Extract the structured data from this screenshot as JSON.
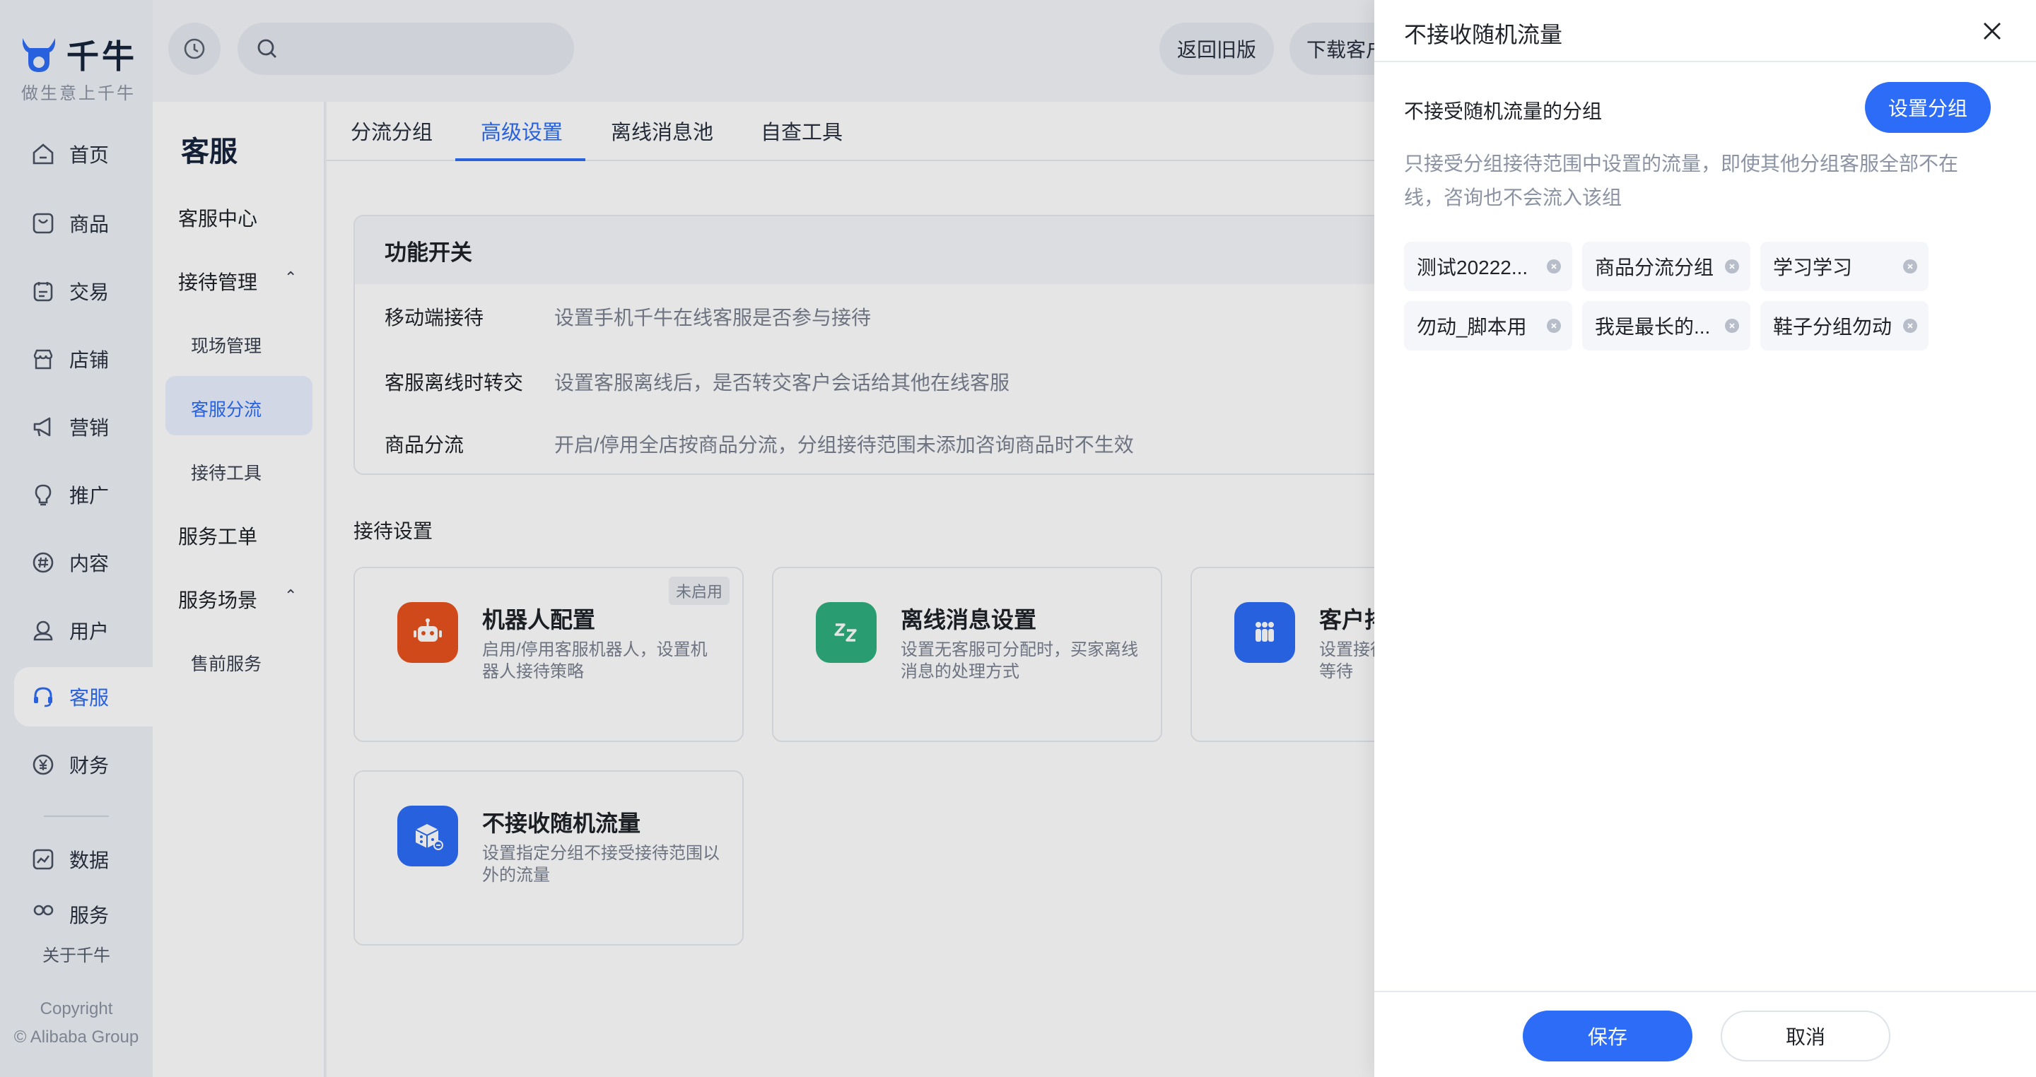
{
  "brand": {
    "name": "千牛",
    "slogan": "做生意上千牛"
  },
  "rail": {
    "items": [
      {
        "label": "首页",
        "icon": "home-icon"
      },
      {
        "label": "商品",
        "icon": "goods-icon"
      },
      {
        "label": "交易",
        "icon": "trade-icon"
      },
      {
        "label": "店铺",
        "icon": "shop-icon"
      },
      {
        "label": "营销",
        "icon": "megaphone-icon"
      },
      {
        "label": "推广",
        "icon": "bulb-icon"
      },
      {
        "label": "内容",
        "icon": "hashtag-icon"
      },
      {
        "label": "用户",
        "icon": "user-icon"
      },
      {
        "label": "客服",
        "icon": "headset-icon",
        "active": true
      },
      {
        "label": "财务",
        "icon": "yuan-icon"
      },
      {
        "label": "数据",
        "icon": "chart-icon"
      },
      {
        "label": "服务",
        "icon": "service-icon"
      }
    ],
    "about": "关于千牛",
    "copyright_1": "Copyright",
    "copyright_2": "© Alibaba Group"
  },
  "topbar": {
    "search_placeholder": "",
    "back_old": "返回旧版",
    "download": "下载客户端"
  },
  "subnav": {
    "title": "客服",
    "items": {
      "center": "客服中心",
      "reception": "接待管理",
      "onsite": "现场管理",
      "routing": "客服分流",
      "tools": "接待工具",
      "tickets": "服务工单",
      "scenes": "服务场景",
      "presale": "售前服务"
    }
  },
  "main": {
    "tabs": [
      "分流分组",
      "高级设置",
      "离线消息池",
      "自查工具"
    ],
    "func_title": "功能开关",
    "func_rows": [
      {
        "label": "移动端接待",
        "desc": "设置手机千牛在线客服是否参与接待"
      },
      {
        "label": "客服离线时转交",
        "desc": "设置客服离线后，是否转交客户会话给其他在线客服"
      },
      {
        "label": "商品分流",
        "desc": "开启/停用全店按商品分流，分组接待范围未添加咨询商品时不生效"
      }
    ],
    "reception_title": "接待设置",
    "cards": [
      {
        "title": "机器人配置",
        "desc": "启用/停用客服机器人，设置机器人接待策略",
        "badge": "未启用",
        "icon": "robot-icon",
        "color": "#e8521f"
      },
      {
        "title": "离线消息设置",
        "desc": "设置无客服可分配时，买家离线消息的处理方式",
        "icon": "sleep-zz-icon",
        "color": "#2fae7f"
      },
      {
        "title": "客户排队",
        "desc": "设置接待上限，超出后客户排队等待",
        "icon": "queue-people-icon",
        "color": "#2c6cf6"
      },
      {
        "title": "不接收随机流量",
        "desc": "设置指定分组不接受接待范围以外的流量",
        "icon": "dice-icon",
        "color": "#2c6cf6"
      }
    ]
  },
  "drawer": {
    "title": "不接收随机流量",
    "group_label": "不接受随机流量的分组",
    "set_group": "设置分组",
    "hint": "只接受分组接待范围中设置的流量，即使其他分组客服全部不在线，咨询也不会流入该组",
    "tags": [
      "测试20222...",
      "商品分流分组",
      "学习学习",
      "勿动_脚本用",
      "我是最长的...",
      "鞋子分组勿动"
    ],
    "save": "保存",
    "cancel": "取消"
  },
  "colors": {
    "accent": "#2c6cf6",
    "robot": "#e8521f",
    "offline": "#2fae7f"
  }
}
